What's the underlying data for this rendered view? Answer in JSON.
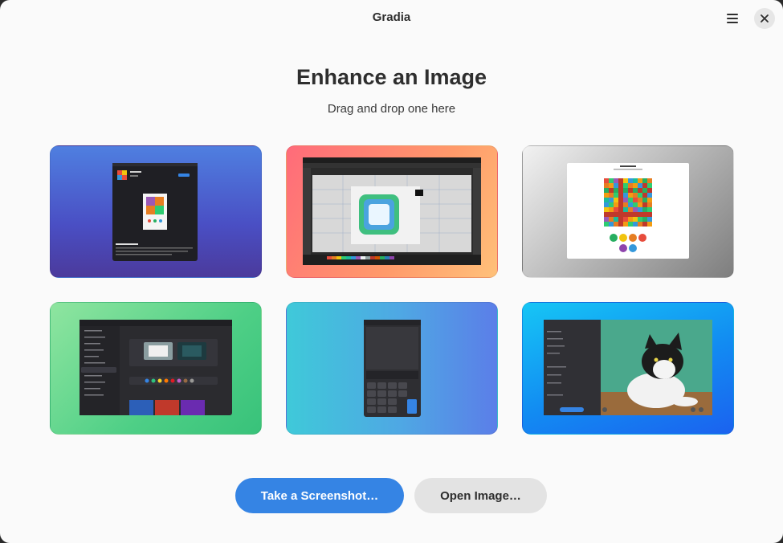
{
  "window": {
    "title": "Gradia"
  },
  "header": {
    "menu_icon": "hamburger-menu-icon",
    "close_icon": "close-icon"
  },
  "main": {
    "title": "Enhance an Image",
    "subtitle": "Drag and drop one here"
  },
  "samples": [
    {
      "name": "app-store-screenshot",
      "background": [
        "#4f7fe0",
        "#4b3a9c"
      ]
    },
    {
      "name": "image-editor-screenshot",
      "background": [
        "#ff6b7a",
        "#ffc17a"
      ]
    },
    {
      "name": "pixel-art-screenshot",
      "background": [
        "#f2f2f2",
        "#7e7e7e"
      ]
    },
    {
      "name": "settings-screenshot",
      "background": [
        "#8fe5a0",
        "#38c27a"
      ]
    },
    {
      "name": "calculator-screenshot",
      "background": [
        "#3fc9d9",
        "#5b7ee8"
      ]
    },
    {
      "name": "cat-photo-editor-screenshot",
      "background": [
        "#16c6f5",
        "#1b62ef"
      ]
    }
  ],
  "actions": {
    "screenshot_label": "Take a Screenshot…",
    "open_label": "Open Image…"
  },
  "colors": {
    "accent": "#3584e4",
    "window_bg": "#fafafa",
    "secondary_button": "#e3e3e3"
  }
}
